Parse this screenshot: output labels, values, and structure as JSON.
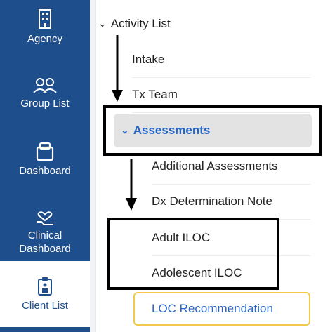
{
  "rail": {
    "items": [
      {
        "label": "Agency",
        "icon": "building-icon"
      },
      {
        "label": "Group List",
        "icon": "group-icon"
      },
      {
        "label": "Dashboard",
        "icon": "dashboard-icon"
      },
      {
        "label": "Clinical Dashboard",
        "icon": "clinical-dashboard-icon"
      },
      {
        "label": "Client List",
        "icon": "client-list-icon",
        "active": true
      }
    ]
  },
  "tree": {
    "activity_list": "Activity List",
    "intake": "Intake",
    "tx_team": "Tx Team",
    "assessments": "Assessments",
    "additional_assessments": "Additional Assessments",
    "dx_determination_note": "Dx Determination Note",
    "adult_iloc": "Adult ILOC",
    "adolescent_iloc": "Adolescent ILOC",
    "loc_recommendation": "LOC Recommendation"
  },
  "colors": {
    "rail_blue": "#1f4e8c",
    "link_blue": "#2366c8",
    "highlight_border": "#f2c94c"
  }
}
